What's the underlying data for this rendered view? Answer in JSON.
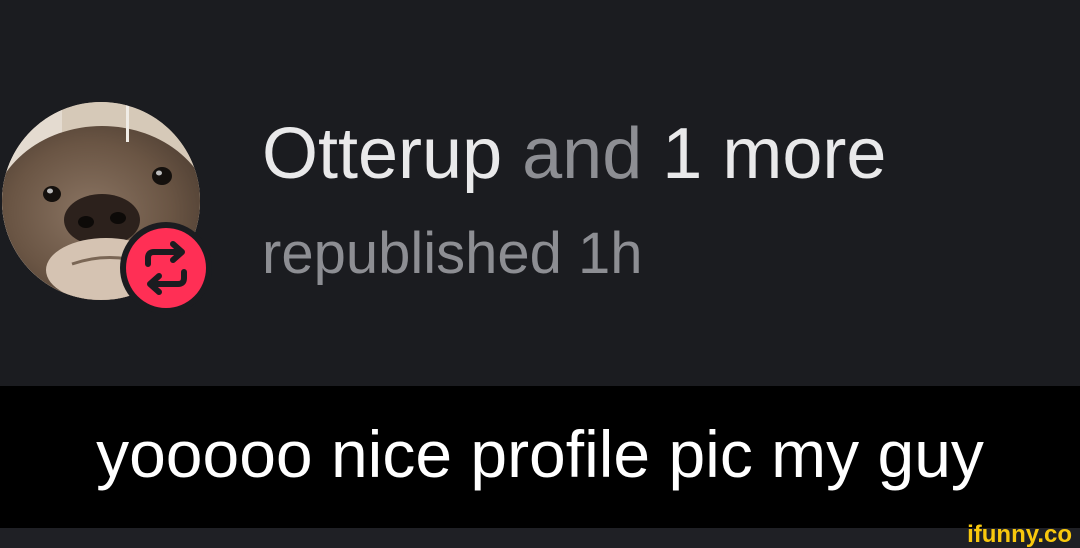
{
  "post": {
    "author": "Otterup",
    "connector": "and",
    "others": "1 more",
    "action": "republished",
    "time": "1h",
    "repost_icon": "repost-arrows-icon",
    "badge_color": "#ff2f55"
  },
  "caption": {
    "text": "yooooo nice profile pic my guy"
  },
  "watermark": {
    "text": "ifunny.co"
  }
}
